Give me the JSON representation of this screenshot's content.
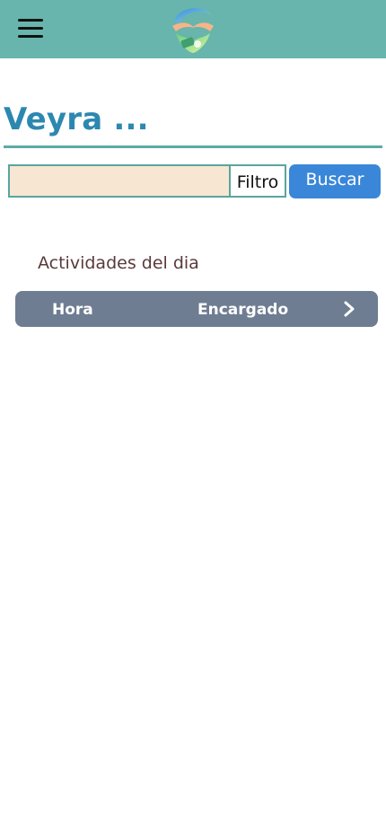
{
  "header": {
    "menu_icon": "hamburger-menu-icon",
    "logo_icon": "hands-heart-logo"
  },
  "page": {
    "title": "Veyra ..."
  },
  "search": {
    "value": "",
    "placeholder": "",
    "filter_label": "Filtro",
    "button_label": "Buscar"
  },
  "activities": {
    "section_title": "Actividades del dia",
    "columns": [
      "Hora",
      "Encargado"
    ],
    "next_icon": "chevron-right-icon",
    "rows": []
  },
  "colors": {
    "header_bg": "#67b5ac",
    "title": "#2c88b0",
    "accent_line": "#5aaca6",
    "input_bg": "#f7e6d1",
    "button_bg": "#3a87d9",
    "table_header_bg": "#6e7d92",
    "section_title": "#5a3a3a"
  }
}
